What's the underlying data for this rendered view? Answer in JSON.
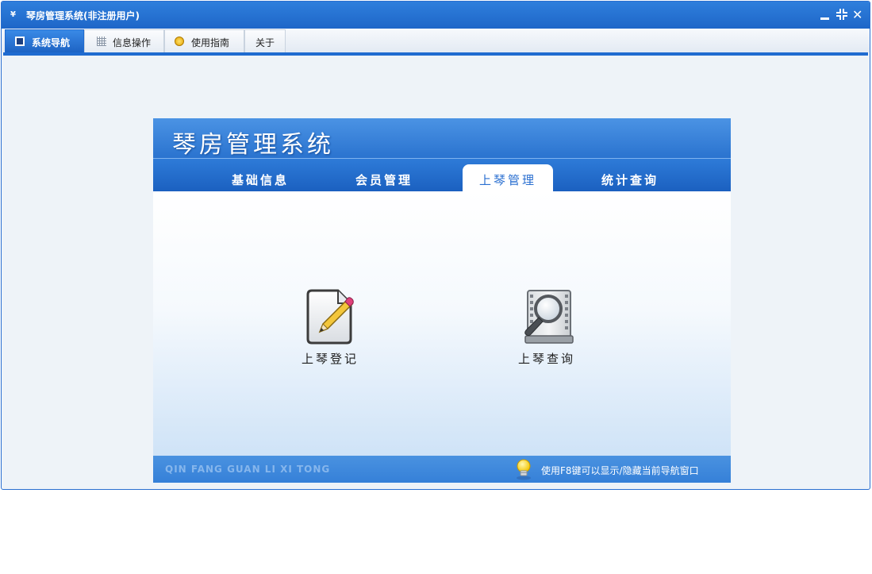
{
  "window": {
    "app_icon": "¥",
    "title": "琴房管理系统(非注册用户)"
  },
  "menubar": {
    "tabs": [
      {
        "label": "系统导航",
        "icon": "monitor-icon"
      },
      {
        "label": "信息操作",
        "icon": "grid-icon"
      },
      {
        "label": "使用指南",
        "icon": "guide-icon"
      },
      {
        "label": "关于",
        "icon": ""
      }
    ],
    "active_index": 0
  },
  "panel": {
    "title": "琴房管理系统",
    "tabs": [
      "基础信息",
      "会员管理",
      "上琴管理",
      "统计查询"
    ],
    "active_index": 2,
    "features": [
      {
        "label": "上琴登记",
        "icon": "edit-document-icon"
      },
      {
        "label": "上琴查询",
        "icon": "magnifier-document-icon"
      }
    ],
    "footer_left": "QIN FANG GUAN LI XI TONG",
    "footer_hint": "使用F8键可以显示/隐藏当前导航窗口"
  },
  "colors": {
    "titlebar": "#2371d2",
    "accent": "#1f6bd0",
    "panel_header": "#3a84dc",
    "active_tab_text": "#2a6fd0"
  }
}
